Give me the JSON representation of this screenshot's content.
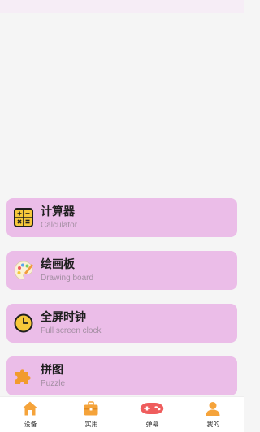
{
  "tools": [
    {
      "title": "计算器",
      "subtitle": "Calculator",
      "icon": "calculator-icon"
    },
    {
      "title": "绘画板",
      "subtitle": "Drawing board",
      "icon": "palette-icon"
    },
    {
      "title": "全屏时钟",
      "subtitle": "Full screen clock",
      "icon": "clock-icon"
    },
    {
      "title": "拼图",
      "subtitle": "Puzzle",
      "icon": "puzzle-icon"
    }
  ],
  "tabbar": {
    "items": [
      {
        "label": "设备",
        "icon": "house-icon"
      },
      {
        "label": "实用",
        "icon": "toolbox-icon"
      },
      {
        "label": "弹幕",
        "icon": "gamepad-icon"
      },
      {
        "label": "我的",
        "icon": "user-icon"
      }
    ]
  },
  "colors": {
    "card_bg": "#ebbde8",
    "page_bg": "#f5f5f5",
    "accent_orange": "#f5a33a",
    "accent_red": "#ef5d5d"
  }
}
